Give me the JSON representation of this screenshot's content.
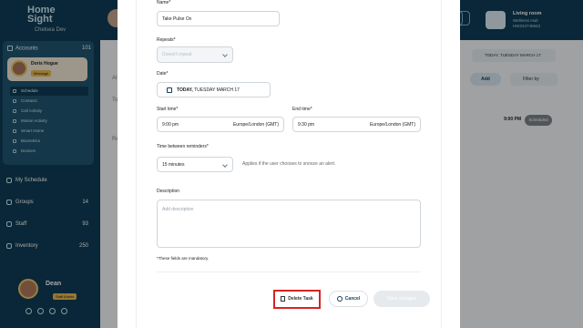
{
  "sidebar": {
    "logo": "Home Sight",
    "org": "Chelsea Dev",
    "accounts": {
      "label": "Accounts",
      "count": "101"
    },
    "person": {
      "name": "Doris Hogue",
      "badge": "Message"
    },
    "sub_items": [
      "Schedule",
      "Contacts",
      "Call Activity",
      "Motion Activity",
      "Smart Home",
      "Biometrics",
      "Devices"
    ],
    "nav": [
      {
        "label": "My Schedule",
        "count": ""
      },
      {
        "label": "Groups",
        "count": "14"
      },
      {
        "label": "Staff",
        "count": "93"
      },
      {
        "label": "Inventory",
        "count": "250"
      }
    ],
    "user": {
      "name": "Dean",
      "badge": "Staff Admin"
    }
  },
  "header": {
    "hub_title": "Living room",
    "hub_line1": "Wellness Hub",
    "hub_line2": "HW234745943"
  },
  "background": {
    "date_chip": "TODAY, TUESDAY MARCH 17",
    "add_label": "Add",
    "filter_label": "Filter by",
    "event_time": "9:00 PM",
    "event_status": "Scheduled",
    "letters": [
      "Al",
      "To",
      "Re"
    ]
  },
  "form": {
    "name_label": "Name*",
    "name_value": "Take Pulse Ox",
    "repeats_label": "Repeats*",
    "repeats_placeholder": "Doesn't repeat",
    "date_label": "Date*",
    "date_value_bold": "TODAY,",
    "date_value": "TUESDAY MARCH 17",
    "start_label": "Start time*",
    "start_value": "9:00 pm",
    "start_tz": "Europe/London (GMT)",
    "end_label": "End time*",
    "end_value": "9:30 pm",
    "end_tz": "Europe/London (GMT)",
    "between_label": "Time between reminders*",
    "between_value": "15 minutes",
    "between_hint": "Applies if the user chooses to snooze an alert.",
    "desc_label": "Description",
    "desc_placeholder": "Add description",
    "mandatory_note": "*These fields are mandatory."
  },
  "actions": {
    "delete": "Delete Task",
    "cancel": "Cancel",
    "save": "Save changes"
  },
  "colors": {
    "sidebar": "#0f3d56",
    "delete_outline": "#d62424",
    "badge_gold": "#e6b84c"
  }
}
